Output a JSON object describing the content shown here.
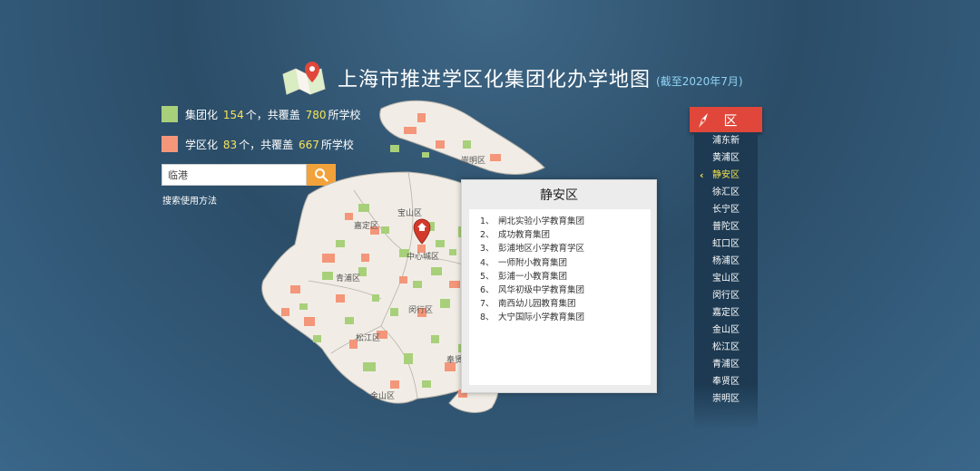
{
  "header": {
    "title": "上海市推进学区化集团化办学地图",
    "subtitle": "(截至2020年7月)",
    "icon": "map-pin-icon"
  },
  "legend": [
    {
      "prefix": "集团化 ",
      "count": "154",
      "middle": "个，共覆盖 ",
      "schools": "780",
      "suffix": "所学校",
      "color": "#a8d07a"
    },
    {
      "prefix": "学区化 ",
      "count": "83",
      "middle": "个，共覆盖 ",
      "schools": "667",
      "suffix": "所学校",
      "color": "#f4967a"
    }
  ],
  "search": {
    "value": "临港",
    "button_icon": "search-icon",
    "help_link": "搜索使用方法"
  },
  "map": {
    "colors": {
      "group": "#a8d07a",
      "district": "#f4967a",
      "land": "#f1ede6",
      "border": "#b8b3a9"
    },
    "labels": [
      "崇明区",
      "宝山区",
      "嘉定区",
      "中心城区",
      "青浦区",
      "闵行区",
      "松江区",
      "奉贤",
      "金山区"
    ],
    "marker_icon": "location-marker-icon"
  },
  "panel": {
    "title": "静安区",
    "items": [
      {
        "idx": "1、",
        "name": "闸北实验小学教育集团"
      },
      {
        "idx": "2、",
        "name": "成功教育集团"
      },
      {
        "idx": "3、",
        "name": "彭浦地区小学教育学区"
      },
      {
        "idx": "4、",
        "name": "一师附小教育集团"
      },
      {
        "idx": "5、",
        "name": "彭浦一小教育集团"
      },
      {
        "idx": "6、",
        "name": "风华初级中学教育集团"
      },
      {
        "idx": "7、",
        "name": "南西幼儿园教育集团"
      },
      {
        "idx": "8、",
        "name": "大宁国际小学教育集团"
      }
    ]
  },
  "districts": {
    "header": "区",
    "header_icon": "compass-icon",
    "selected": "静安区",
    "accent": "#f3e04a",
    "items": [
      "浦东新",
      "黄浦区",
      "静安区",
      "徐汇区",
      "长宁区",
      "普陀区",
      "虹口区",
      "杨浦区",
      "宝山区",
      "闵行区",
      "嘉定区",
      "金山区",
      "松江区",
      "青浦区",
      "奉贤区",
      "崇明区"
    ]
  }
}
